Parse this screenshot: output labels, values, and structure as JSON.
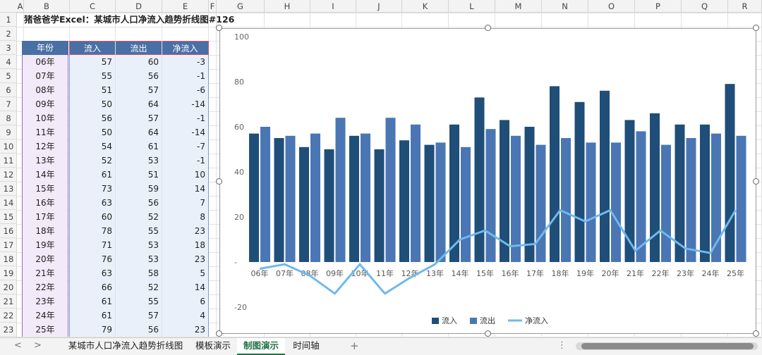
{
  "columns": [
    "A",
    "B",
    "C",
    "D",
    "E",
    "F",
    "G",
    "H",
    "I",
    "J",
    "K",
    "L",
    "M",
    "N",
    "O",
    "P",
    "Q",
    "R"
  ],
  "rows": [
    "1",
    "2",
    "3",
    "4",
    "5",
    "6",
    "7",
    "8",
    "9",
    "10",
    "11",
    "12",
    "13",
    "14",
    "15",
    "16",
    "17",
    "18",
    "19",
    "20",
    "21",
    "22",
    "23"
  ],
  "title": "猪爸爸学Excel：某城市人口净流入趋势折线图#126",
  "table": {
    "headers": [
      "年份",
      "流入",
      "流出",
      "净流入"
    ],
    "rows": [
      [
        "06年",
        "57",
        "60",
        "-3"
      ],
      [
        "07年",
        "55",
        "56",
        "-1"
      ],
      [
        "08年",
        "51",
        "57",
        "-6"
      ],
      [
        "09年",
        "50",
        "64",
        "-14"
      ],
      [
        "10年",
        "56",
        "57",
        "-1"
      ],
      [
        "11年",
        "50",
        "64",
        "-14"
      ],
      [
        "12年",
        "54",
        "61",
        "-7"
      ],
      [
        "13年",
        "52",
        "53",
        "-1"
      ],
      [
        "14年",
        "61",
        "51",
        "10"
      ],
      [
        "15年",
        "73",
        "59",
        "14"
      ],
      [
        "16年",
        "63",
        "56",
        "7"
      ],
      [
        "17年",
        "60",
        "52",
        "8"
      ],
      [
        "18年",
        "78",
        "55",
        "23"
      ],
      [
        "19年",
        "71",
        "53",
        "18"
      ],
      [
        "20年",
        "76",
        "53",
        "23"
      ],
      [
        "21年",
        "63",
        "58",
        "5"
      ],
      [
        "22年",
        "66",
        "52",
        "14"
      ],
      [
        "23年",
        "61",
        "55",
        "6"
      ],
      [
        "24年",
        "61",
        "57",
        "4"
      ],
      [
        "25年",
        "79",
        "56",
        "23"
      ]
    ]
  },
  "chart_data": {
    "type": "bar",
    "categories": [
      "06年",
      "07年",
      "08年",
      "09年",
      "10年",
      "11年",
      "12年",
      "13年",
      "14年",
      "15年",
      "16年",
      "17年",
      "18年",
      "19年",
      "20年",
      "21年",
      "22年",
      "23年",
      "24年",
      "25年"
    ],
    "series": [
      {
        "name": "流入",
        "type": "bar",
        "color": "#1f4e79",
        "values": [
          57,
          55,
          51,
          50,
          56,
          50,
          54,
          52,
          61,
          73,
          63,
          60,
          78,
          71,
          76,
          63,
          66,
          61,
          61,
          79
        ]
      },
      {
        "name": "流出",
        "type": "bar",
        "color": "#4a76b4",
        "values": [
          60,
          56,
          57,
          64,
          57,
          64,
          61,
          53,
          51,
          59,
          56,
          52,
          55,
          53,
          53,
          58,
          52,
          55,
          57,
          56
        ]
      },
      {
        "name": "净流入",
        "type": "line",
        "color": "#6fb9ec",
        "values": [
          -3,
          -1,
          -6,
          -14,
          -1,
          -14,
          -7,
          -1,
          10,
          14,
          7,
          8,
          23,
          18,
          23,
          5,
          14,
          6,
          4,
          23
        ]
      }
    ],
    "yticks": [
      "100",
      "80",
      "60",
      "40",
      "20",
      "-",
      "-20"
    ],
    "ylim": [
      -20,
      100
    ],
    "legend": "bottom",
    "grid": false
  },
  "sheet_tabs": [
    "某城市人口净流入趋势折线图",
    "模板演示",
    "制图演示",
    "时间轴"
  ],
  "active_tab": "制图演示",
  "nav": {
    "prev": "<",
    "next": ">",
    "add": "+",
    "more": "⋮"
  }
}
